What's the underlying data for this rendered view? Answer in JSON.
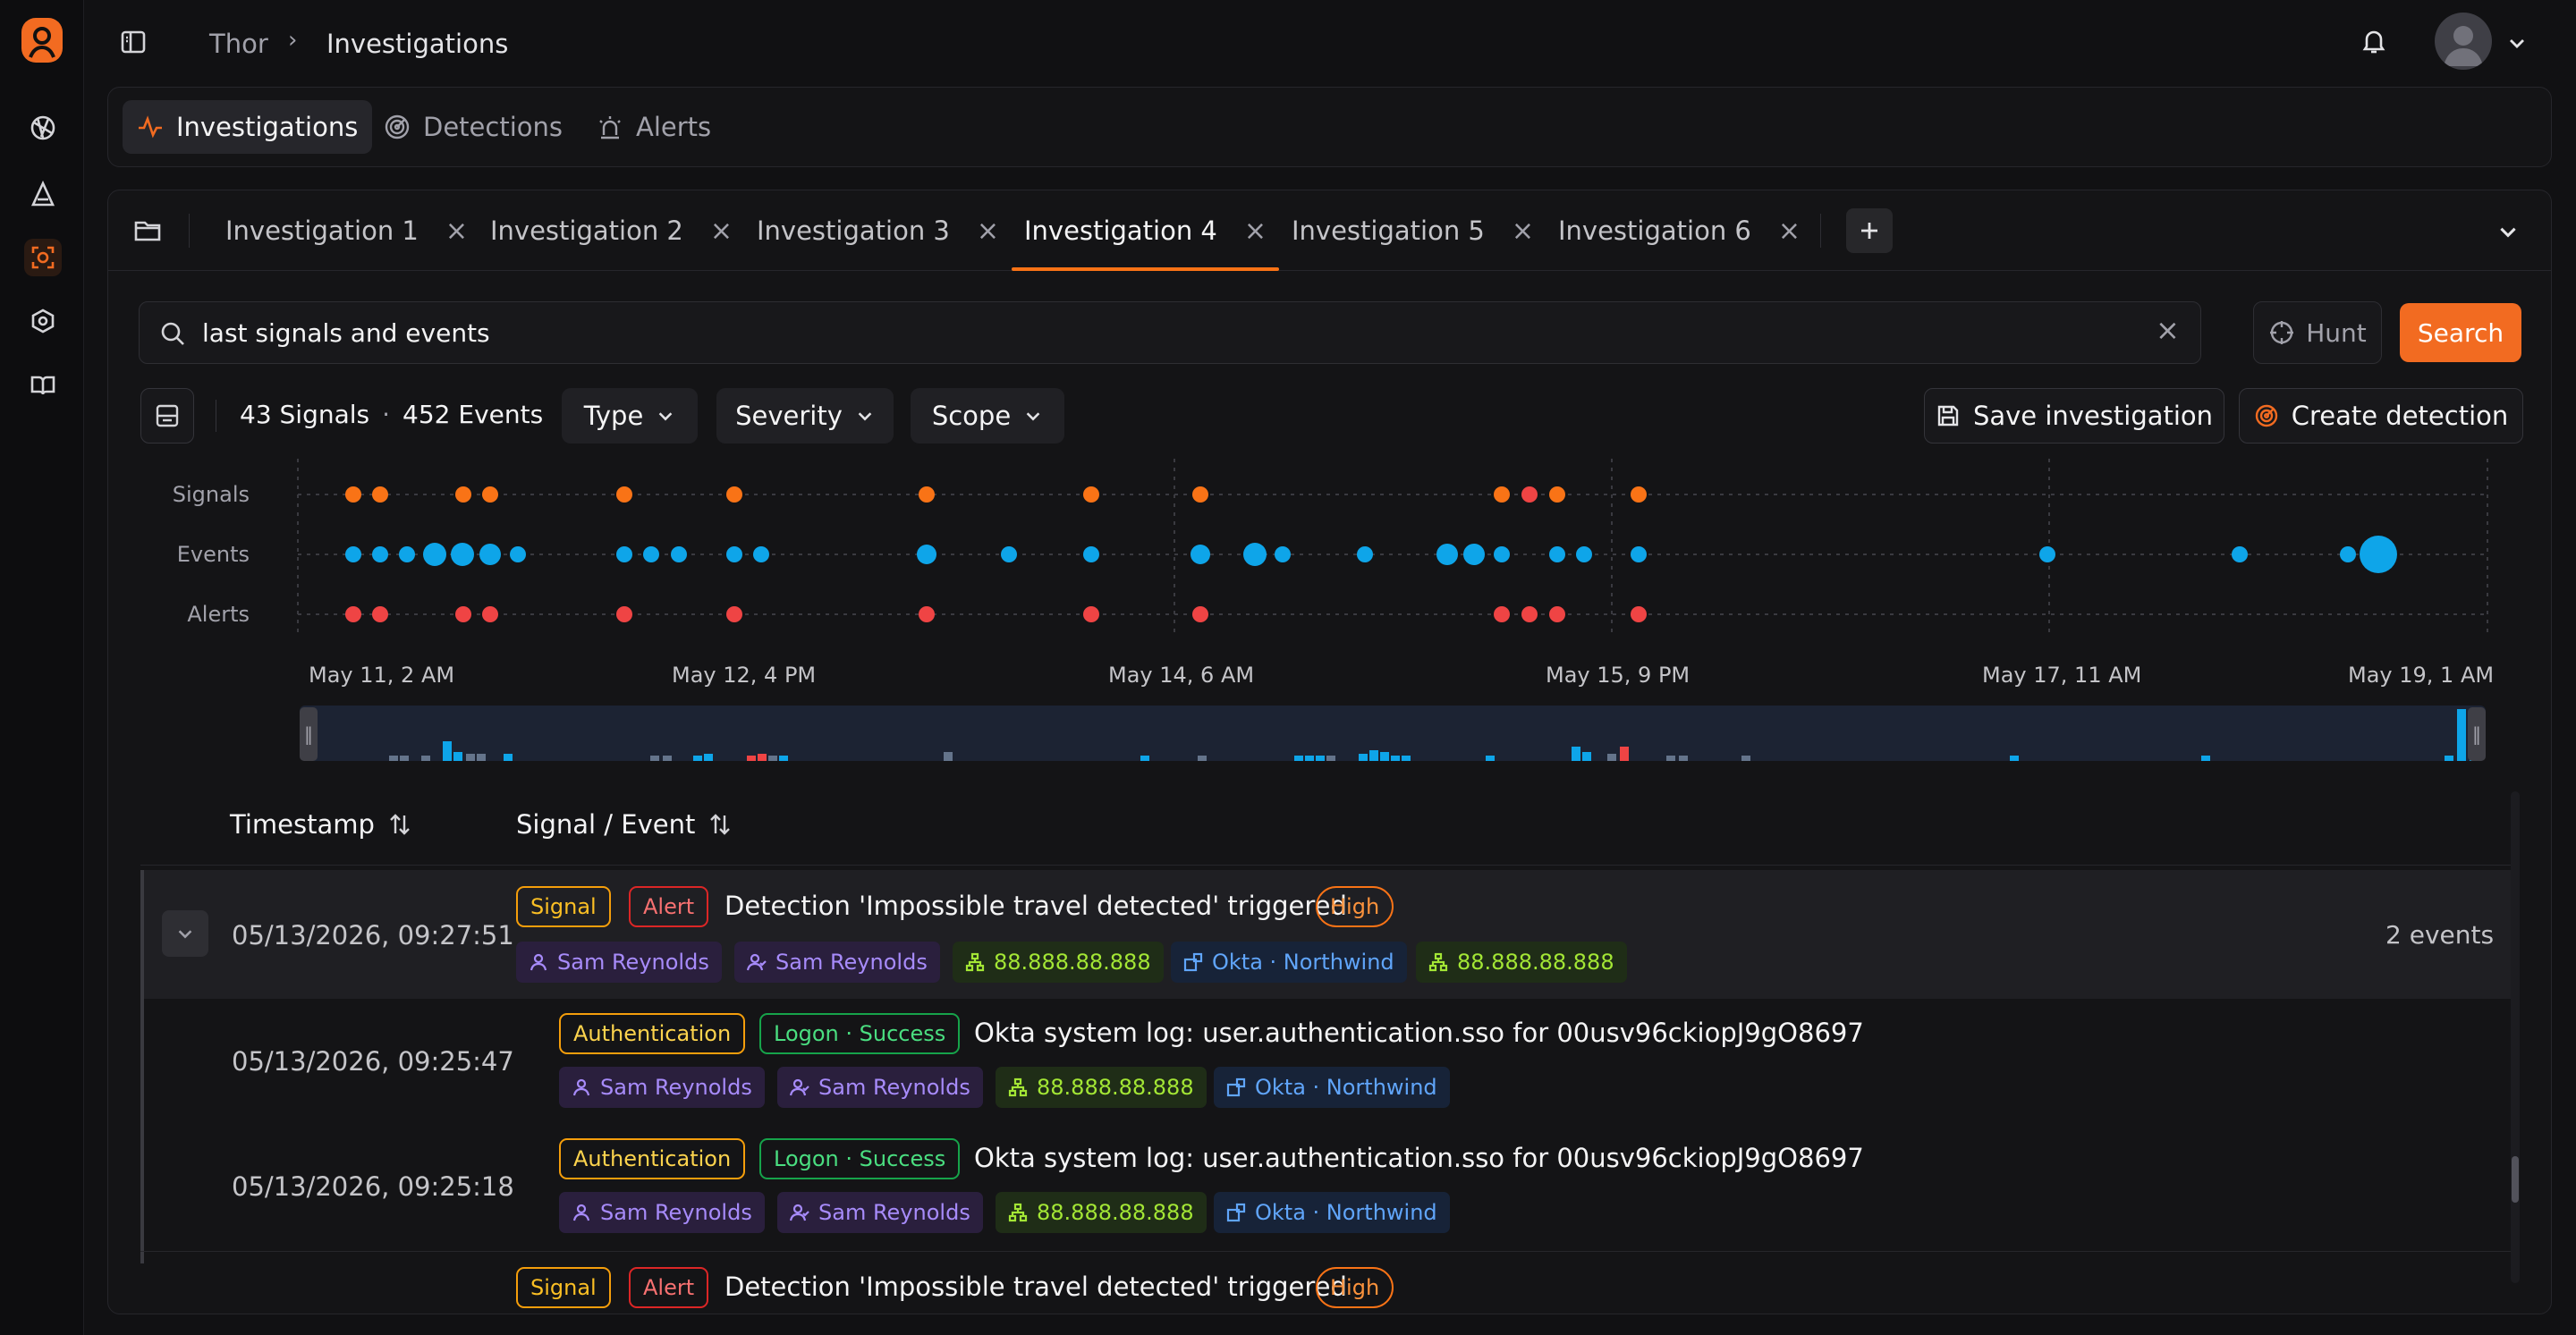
{
  "app": {
    "logo_icon": "user-circle-logo-icon",
    "accent": "#f26b21"
  },
  "sidebar": {
    "items": [
      {
        "icon": "globe-icon"
      },
      {
        "icon": "triangle-icon"
      },
      {
        "icon": "investigation-icon",
        "active": true
      },
      {
        "icon": "hexagon-icon"
      },
      {
        "icon": "book-icon"
      }
    ]
  },
  "breadcrumb": {
    "root": "Thor",
    "separator": ">",
    "current": "Investigations"
  },
  "nav": {
    "tabs": [
      {
        "label": "Investigations",
        "icon": "activity-icon",
        "active": true
      },
      {
        "label": "Detections",
        "icon": "radar-icon"
      },
      {
        "label": "Alerts",
        "icon": "siren-icon"
      }
    ]
  },
  "investigation_tabs": [
    {
      "label": "Investigation 1"
    },
    {
      "label": "Investigation 2"
    },
    {
      "label": "Investigation 3"
    },
    {
      "label": "Investigation 4",
      "active": true
    },
    {
      "label": "Investigation 5"
    },
    {
      "label": "Investigation 6"
    }
  ],
  "search": {
    "value": "last signals and events",
    "hunt_label": "Hunt",
    "search_label": "Search"
  },
  "summary": {
    "signals": "43 Signals",
    "dot": "·",
    "events": "452 Events"
  },
  "filters": {
    "type": "Type",
    "severity": "Severity",
    "scope": "Scope"
  },
  "actions": {
    "save": "Save investigation",
    "create": "Create detection"
  },
  "timeline": {
    "row_labels": [
      "Signals",
      "Events",
      "Alerts"
    ],
    "axis_labels": [
      "May 11, 2 AM",
      "May 12, 4 PM",
      "May 14, 6 AM",
      "May 15, 9 PM",
      "May 17, 11 AM",
      "May 19, 1 AM"
    ],
    "colors": {
      "signals": "#f97316",
      "signals_alt": "#ef4444",
      "events": "#0ea5e9",
      "alerts": "#ef4444"
    }
  },
  "table": {
    "headers": {
      "timestamp": "Timestamp",
      "signal_event": "Signal / Event"
    },
    "rows": [
      {
        "timestamp": "05/13/2026, 09:27:51",
        "badges": [
          "Signal",
          "Alert"
        ],
        "title": "Detection 'Impossible travel detected' triggered",
        "severity": "High",
        "chips": [
          "Sam Reynolds",
          "Sam Reynolds",
          "88.888.88.888",
          "Okta · Northwind",
          "88.888.88.888"
        ],
        "count": "2 events"
      },
      {
        "timestamp": "05/13/2026, 09:25:47",
        "badges": [
          "Authentication",
          "Logon · Success"
        ],
        "title": "Okta system log: user.authentication.sso for 00usv96ckiopJ9gO8697",
        "chips": [
          "Sam Reynolds",
          "Sam Reynolds",
          "88.888.88.888",
          "Okta · Northwind"
        ]
      },
      {
        "timestamp": "05/13/2026, 09:25:18",
        "badges": [
          "Authentication",
          "Logon · Success"
        ],
        "title": "Okta system log: user.authentication.sso for 00usv96ckiopJ9gO8697",
        "chips": [
          "Sam Reynolds",
          "Sam Reynolds",
          "88.888.88.888",
          "Okta · Northwind"
        ]
      },
      {
        "badges": [
          "Signal",
          "Alert"
        ],
        "title": "Detection 'Impossible travel detected' triggered",
        "severity": "High"
      }
    ]
  }
}
